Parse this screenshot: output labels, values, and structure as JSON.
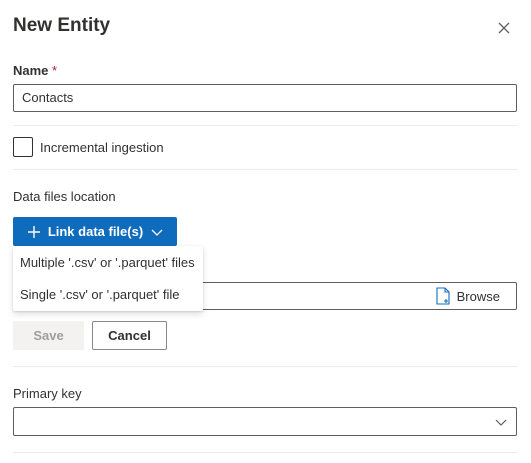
{
  "dialog": {
    "title": "New Entity",
    "close_icon": "close-icon"
  },
  "name_field": {
    "label": "Name",
    "required_marker": "*",
    "value": "Contacts"
  },
  "incremental": {
    "label": "Incremental ingestion",
    "checked": false
  },
  "data_files": {
    "label": "Data files location",
    "link_button_label": "Link data file(s)",
    "link_button_icon": "plus-icon",
    "link_button_chevron": "chevron-down-icon",
    "browse_label": "Browse",
    "browse_icon": "file-icon",
    "menu": [
      {
        "label": "Multiple '.csv' or '.parquet' files"
      },
      {
        "label": "Single '.csv' or '.parquet' file"
      }
    ]
  },
  "actions": {
    "save_label": "Save",
    "save_disabled": true,
    "cancel_label": "Cancel"
  },
  "primary_key": {
    "label": "Primary key",
    "value": "",
    "chevron_icon": "chevron-down-icon"
  },
  "colors": {
    "accent": "#0f6cbd",
    "text": "#323130",
    "border": "#605e5c",
    "divider": "#edebe9",
    "disabled_bg": "#f3f2f1",
    "disabled_text": "#a19f9d"
  }
}
